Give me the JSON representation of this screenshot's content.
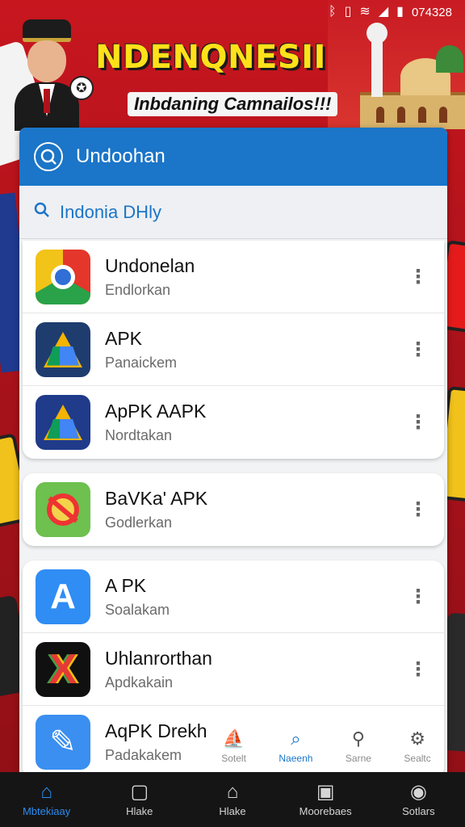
{
  "status": {
    "time": "074328",
    "icons": [
      "bluetooth-icon",
      "vibrate-icon",
      "wifi-icon",
      "signal-icon",
      "battery-icon"
    ]
  },
  "banner": {
    "title": "NDENQNESII",
    "subtitle": "Inbdaning Camnailos!!!"
  },
  "appbar": {
    "title": "Undoohan",
    "accent": "#1b75c8"
  },
  "search": {
    "value": "Indonia DHly"
  },
  "groups": [
    [
      {
        "name": "Undonelan",
        "sub": "Endlorkan",
        "icon": "chrome-icon"
      },
      {
        "name": "APK",
        "sub": "Panaickem",
        "icon": "drive-icon"
      },
      {
        "name": "ApPK AAPK",
        "sub": "Nordtakan",
        "icon": "drive-icon"
      }
    ],
    [
      {
        "name": "BaVKa' APK",
        "sub": "Godlerkan",
        "icon": "warning-icon"
      }
    ],
    [
      {
        "name": "A PK",
        "sub": "Soalakam",
        "icon": "appstore-icon"
      },
      {
        "name": "Uhlanrorthan",
        "sub": "Apdkakain",
        "icon": "x-icon"
      },
      {
        "name": "AqPK Drekh",
        "sub": "Padakakem",
        "icon": "feather-icon"
      }
    ]
  ],
  "inner_nav": [
    {
      "label": "Sotelt",
      "icon": "ship-icon"
    },
    {
      "label": "Naeenh",
      "icon": "magnifier-icon"
    },
    {
      "label": "Sarne",
      "icon": "search-icon"
    },
    {
      "label": "Sealtc",
      "icon": "settings-icon"
    }
  ],
  "bottom_nav": [
    {
      "label": "Mbtekiaay",
      "icon": "home-icon"
    },
    {
      "label": "Hlake",
      "icon": "chat-icon"
    },
    {
      "label": "Hlake",
      "icon": "house-outline-icon"
    },
    {
      "label": "Moorebaes",
      "icon": "photo-icon"
    },
    {
      "label": "Sotlars",
      "icon": "profile-icon"
    }
  ]
}
